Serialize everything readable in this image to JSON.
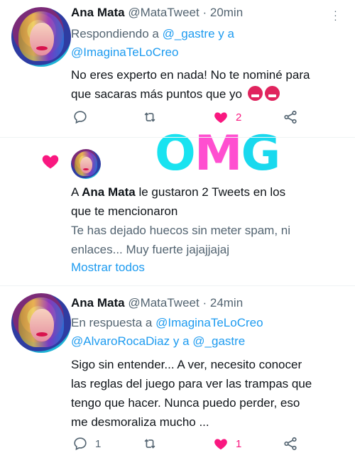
{
  "tweet1": {
    "name": "Ana Mata",
    "handle": "@MataTweet",
    "separator": "·",
    "time": "20min",
    "reply_prefix": "Respondiendo a",
    "mention1": "@_gastre",
    "and": "y a",
    "mention2": "@ImaginaTeLoCreo",
    "text_line1": "No eres experto en nada! No te nominé para",
    "text_line2": "que sacaras más puntos que yo",
    "emojis": [
      "angry-face",
      "angry-face"
    ],
    "actions": {
      "reply_count": "",
      "retweet_count": "",
      "like_count": "2",
      "liked": true
    }
  },
  "notification": {
    "prefix": "A",
    "name": "Ana Mata",
    "suffix": "le gustaron 2 Tweets en los",
    "line2": "que te mencionaron",
    "preview_line1": "Te has dejado huecos sin meter spam, ni",
    "preview_line2": "enlaces... Muy fuerte jajajjajaj",
    "show_all": "Mostrar todos"
  },
  "overlay": {
    "letters": [
      "O",
      "M",
      "G"
    ],
    "colors": [
      "#19e3f0",
      "#ff4fd0",
      "#19d9ee"
    ]
  },
  "tweet2": {
    "name": "Ana Mata",
    "handle": "@MataTweet",
    "separator": "·",
    "time": "24min",
    "reply_prefix": "En respuesta a",
    "mention1": "@ImaginaTeLoCreo",
    "mention2": "@AlvaroRocaDiaz",
    "and": "y a",
    "mention3": "@_gastre",
    "text_line1": "Sigo sin entender... A ver, necesito conocer",
    "text_line2": "las reglas del juego para ver las trampas que",
    "text_line3": "tengo que hacer. Nunca puedo perder, eso",
    "text_line4": "me desmoraliza mucho ...",
    "actions": {
      "reply_count": "1",
      "retweet_count": "",
      "like_count": "1",
      "liked": true
    }
  },
  "colors": {
    "link": "#1d9bf0",
    "like": "#f91880",
    "muted": "#536471"
  }
}
